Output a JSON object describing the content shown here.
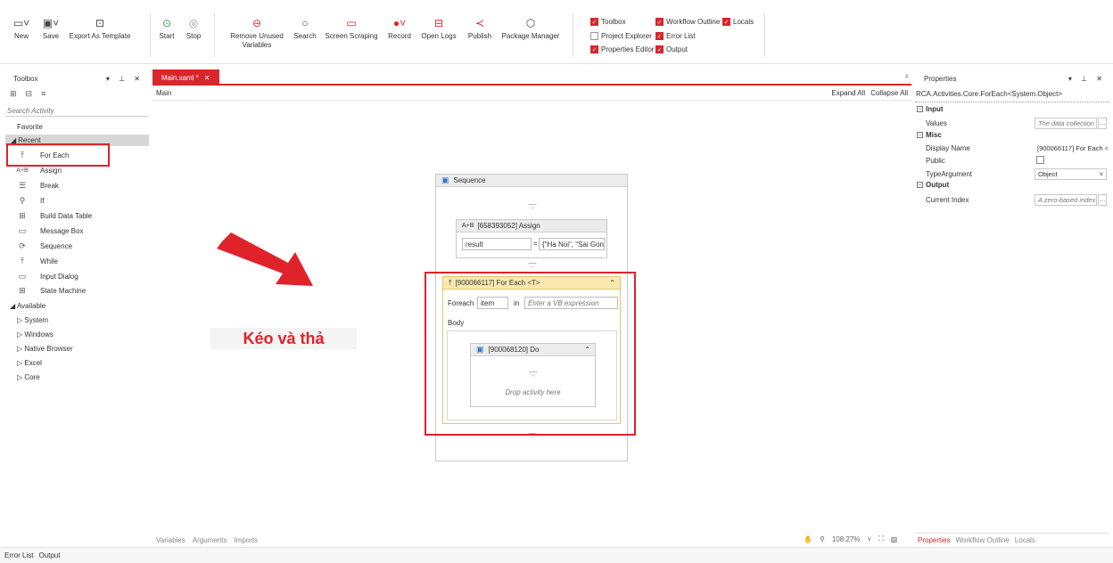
{
  "ribbon": {
    "buttons": [
      {
        "label": "New",
        "icon": "new-file-icon"
      },
      {
        "label": "Save",
        "icon": "save-icon"
      },
      {
        "label": "Export As Template",
        "icon": "export-template-icon"
      },
      {
        "label": "Start",
        "icon": "play-icon"
      },
      {
        "label": "Stop",
        "icon": "stop-icon"
      },
      {
        "label": "Remove Unused Variables",
        "icon": "remove-variables-icon"
      },
      {
        "label": "Search",
        "icon": "search-icon"
      },
      {
        "label": "Screen Scraping",
        "icon": "screen-scraping-icon"
      },
      {
        "label": "Record",
        "icon": "record-icon"
      },
      {
        "label": "Open Logs",
        "icon": "open-logs-icon"
      },
      {
        "label": "Publish",
        "icon": "publish-icon"
      },
      {
        "label": "Package Manager",
        "icon": "package-icon"
      }
    ],
    "remove_line1": "Remove Unused",
    "remove_line2": "Variables",
    "checkboxes": [
      {
        "label": "Toolbox",
        "checked": true
      },
      {
        "label": "Workflow Outline",
        "checked": true
      },
      {
        "label": "Locals",
        "checked": true
      },
      {
        "label": "Project Explorer",
        "checked": false
      },
      {
        "label": "Error List",
        "checked": true
      },
      {
        "label": "Properties Editor",
        "checked": true
      },
      {
        "label": "Output",
        "checked": true
      }
    ]
  },
  "toolbox": {
    "title": "Toolbox",
    "search_placeholder": "Search Activity",
    "favorite": "Favorite",
    "recent": "Recent",
    "recent_items": [
      "For Each",
      "Assign",
      "Break",
      "If",
      "Build Data Table",
      "Message Box",
      "Sequence",
      "While",
      "Input Dialog",
      "State Machine"
    ],
    "available": "Available",
    "available_items": [
      "System",
      "Windows",
      "Native Browser",
      "Excel",
      "Core"
    ]
  },
  "designer": {
    "tab": "Main.xaml *",
    "breadcrumb": "Main",
    "expand_all": "Expand All",
    "collapse_all": "Collapse All",
    "sequence_title": "Sequence",
    "assign_title": "[658393052] Assign",
    "assign_to": "result",
    "assign_value": "{\"Ha Noi\", \"Sai Gon\"}",
    "foreach_title": "[900066117] For Each <T>",
    "foreach_label": "Foreach",
    "foreach_item": "item",
    "in_label": "in",
    "in_placeholder": "Enter a VB expression",
    "body_label": "Body",
    "do_title": "[900068120] Do",
    "drop_hint": "Drop activity here",
    "annotation": "Kéo và thả",
    "bottom_tabs": [
      "Variables",
      "Arguments",
      "Imports"
    ],
    "zoom": "108.27%"
  },
  "properties": {
    "title": "Properties",
    "type_name": "RCA.Activities.Core.ForEach<System.Object>",
    "sections": {
      "input": "Input",
      "misc": "Misc",
      "output": "Output"
    },
    "values_label": "Values",
    "values_placeholder": "The data collection",
    "display_name_label": "Display Name",
    "display_name_value": "[900066117] For Each <",
    "public_label": "Public",
    "type_argument_label": "TypeArgument",
    "type_argument_value": "Object",
    "current_index_label": "Current Index",
    "current_index_placeholder": "A zero-based index",
    "bottom_tabs": [
      "Properties",
      "Workflow Outline",
      "Locals"
    ]
  },
  "statusbar": {
    "tabs": [
      "Error List",
      "Output"
    ]
  },
  "colors": {
    "accent": "#d9262c",
    "foreach_header": "#fbe8b0",
    "foreach_border": "#e8c56a",
    "highlight_box": "#e0222a"
  }
}
